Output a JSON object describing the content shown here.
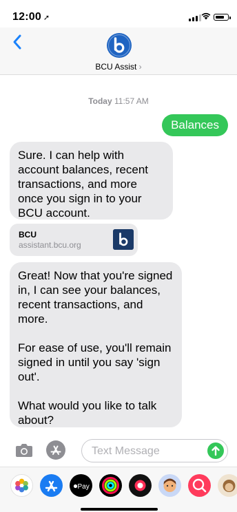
{
  "status_bar": {
    "time": "12:00",
    "location_glyph": "➚"
  },
  "header": {
    "contact_name": "BCU Assist",
    "contact_chevron": "›",
    "avatar_letter": "b",
    "brand_color": "#1f64c2"
  },
  "conversation": {
    "timestamp_day": "Today",
    "timestamp_time": "11:57 AM",
    "outgoing": {
      "text": "Balances",
      "color": "#34c759"
    },
    "incoming_1": {
      "text": "Sure. I can help with account balances, recent transactions, and more once you sign in to your BCU account."
    },
    "link_preview": {
      "title": "BCU",
      "url": "assistant.bcu.org",
      "logo_letter": "b",
      "logo_color": "#1b3a68"
    },
    "incoming_2": {
      "p1": "Great! Now that you're signed in, I can see your balances, recent transactions, and more.",
      "p2": "For ease of use, you'll remain signed in until you say 'sign out'.",
      "p3": "What would you like to talk about?"
    }
  },
  "input_bar": {
    "placeholder": "Text Message"
  },
  "app_strip": {
    "apps": [
      {
        "name": "photos-app-icon"
      },
      {
        "name": "app-store-app-icon"
      },
      {
        "name": "apple-pay-app-icon",
        "label": "Pay"
      },
      {
        "name": "activity-app-icon"
      },
      {
        "name": "digital-touch-app-icon"
      },
      {
        "name": "memoji-app-icon"
      },
      {
        "name": "images-search-app-icon"
      },
      {
        "name": "animoji-app-icon"
      }
    ]
  }
}
